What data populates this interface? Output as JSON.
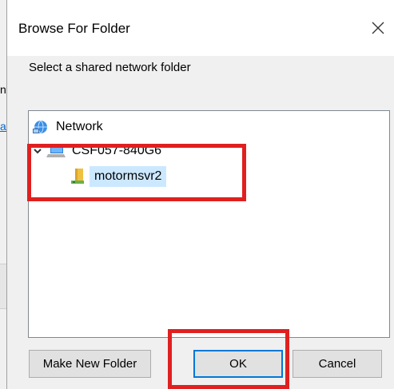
{
  "background": {
    "fragment_1": "nt",
    "fragment_2": "ar"
  },
  "dialog": {
    "title": "Browse For Folder",
    "prompt": "Select a shared network folder",
    "tree": {
      "items": [
        {
          "label": "Network",
          "icon": "network-icon"
        },
        {
          "label": "CSF057-840G6",
          "icon": "computer-icon",
          "expanded": true
        },
        {
          "label": "motormsvr2",
          "icon": "shared-folder-icon",
          "selected": true
        }
      ]
    },
    "buttons": {
      "make_new_folder": "Make New Folder",
      "ok": "OK",
      "cancel": "Cancel"
    }
  },
  "annotation_color": "#e02020",
  "selection_color": "#cce8ff"
}
